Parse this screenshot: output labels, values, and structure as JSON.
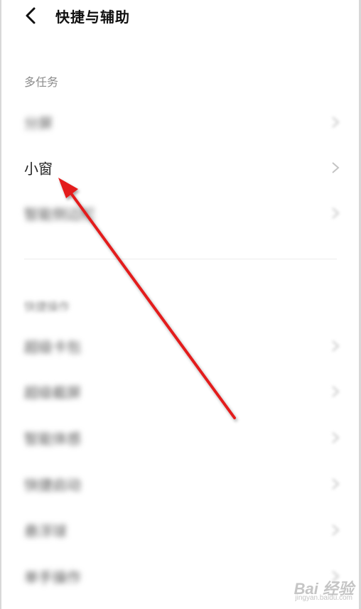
{
  "header": {
    "title": "快捷与辅助",
    "back_icon": "chevron-left-icon"
  },
  "sections": [
    {
      "label": "多任务",
      "items": [
        {
          "label": "分屏"
        },
        {
          "label": "小窗"
        },
        {
          "label": "智能侧边栏"
        }
      ]
    },
    {
      "label": "快捷操作",
      "items": [
        {
          "label": "超级卡包"
        },
        {
          "label": "超级截屏"
        },
        {
          "label": "智能体感"
        },
        {
          "label": "快捷启动"
        },
        {
          "label": "悬浮球"
        },
        {
          "label": "单手操作"
        }
      ]
    }
  ],
  "annotation": {
    "color": "#e31b1b",
    "target": "小窗"
  },
  "watermark": {
    "brand": "Bai 经验",
    "site": "jingyan.baidu.com"
  }
}
